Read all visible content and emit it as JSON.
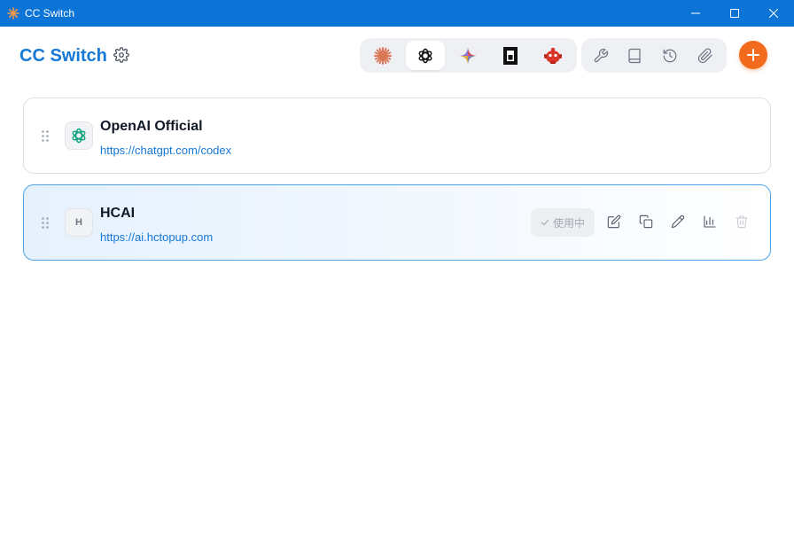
{
  "window": {
    "title": "CC Switch"
  },
  "header": {
    "title": "CC Switch"
  },
  "app_switcher": {
    "items": [
      {
        "name": "claude",
        "icon": "claude-starburst-icon",
        "color": "#d97757",
        "active": false
      },
      {
        "name": "codex",
        "icon": "openai-icon",
        "color": "#111111",
        "active": true
      },
      {
        "name": "gemini",
        "icon": "gemini-sparkle-icon",
        "color": "#4285f4",
        "active": false
      },
      {
        "name": "opencode",
        "icon": "terminal-block-icon",
        "color": "#111111",
        "active": false
      },
      {
        "name": "droid",
        "icon": "robot-icon",
        "color": "#d9362b",
        "active": false
      }
    ]
  },
  "tools": {
    "items": [
      {
        "icon": "wrench-icon"
      },
      {
        "icon": "book-icon"
      },
      {
        "icon": "history-icon"
      },
      {
        "icon": "paperclip-icon"
      }
    ]
  },
  "colors": {
    "accent": "#1478d6",
    "add": "#f26b1d",
    "titlebar": "#0b74d6"
  },
  "providers": [
    {
      "name": "OpenAI Official",
      "url": "https://chatgpt.com/codex",
      "avatar_icon": "openai-icon",
      "active": false
    },
    {
      "name": "HCAI",
      "url": "https://ai.hctopup.com",
      "avatar_letter": "H",
      "active": true,
      "status_label": "使用中"
    }
  ]
}
